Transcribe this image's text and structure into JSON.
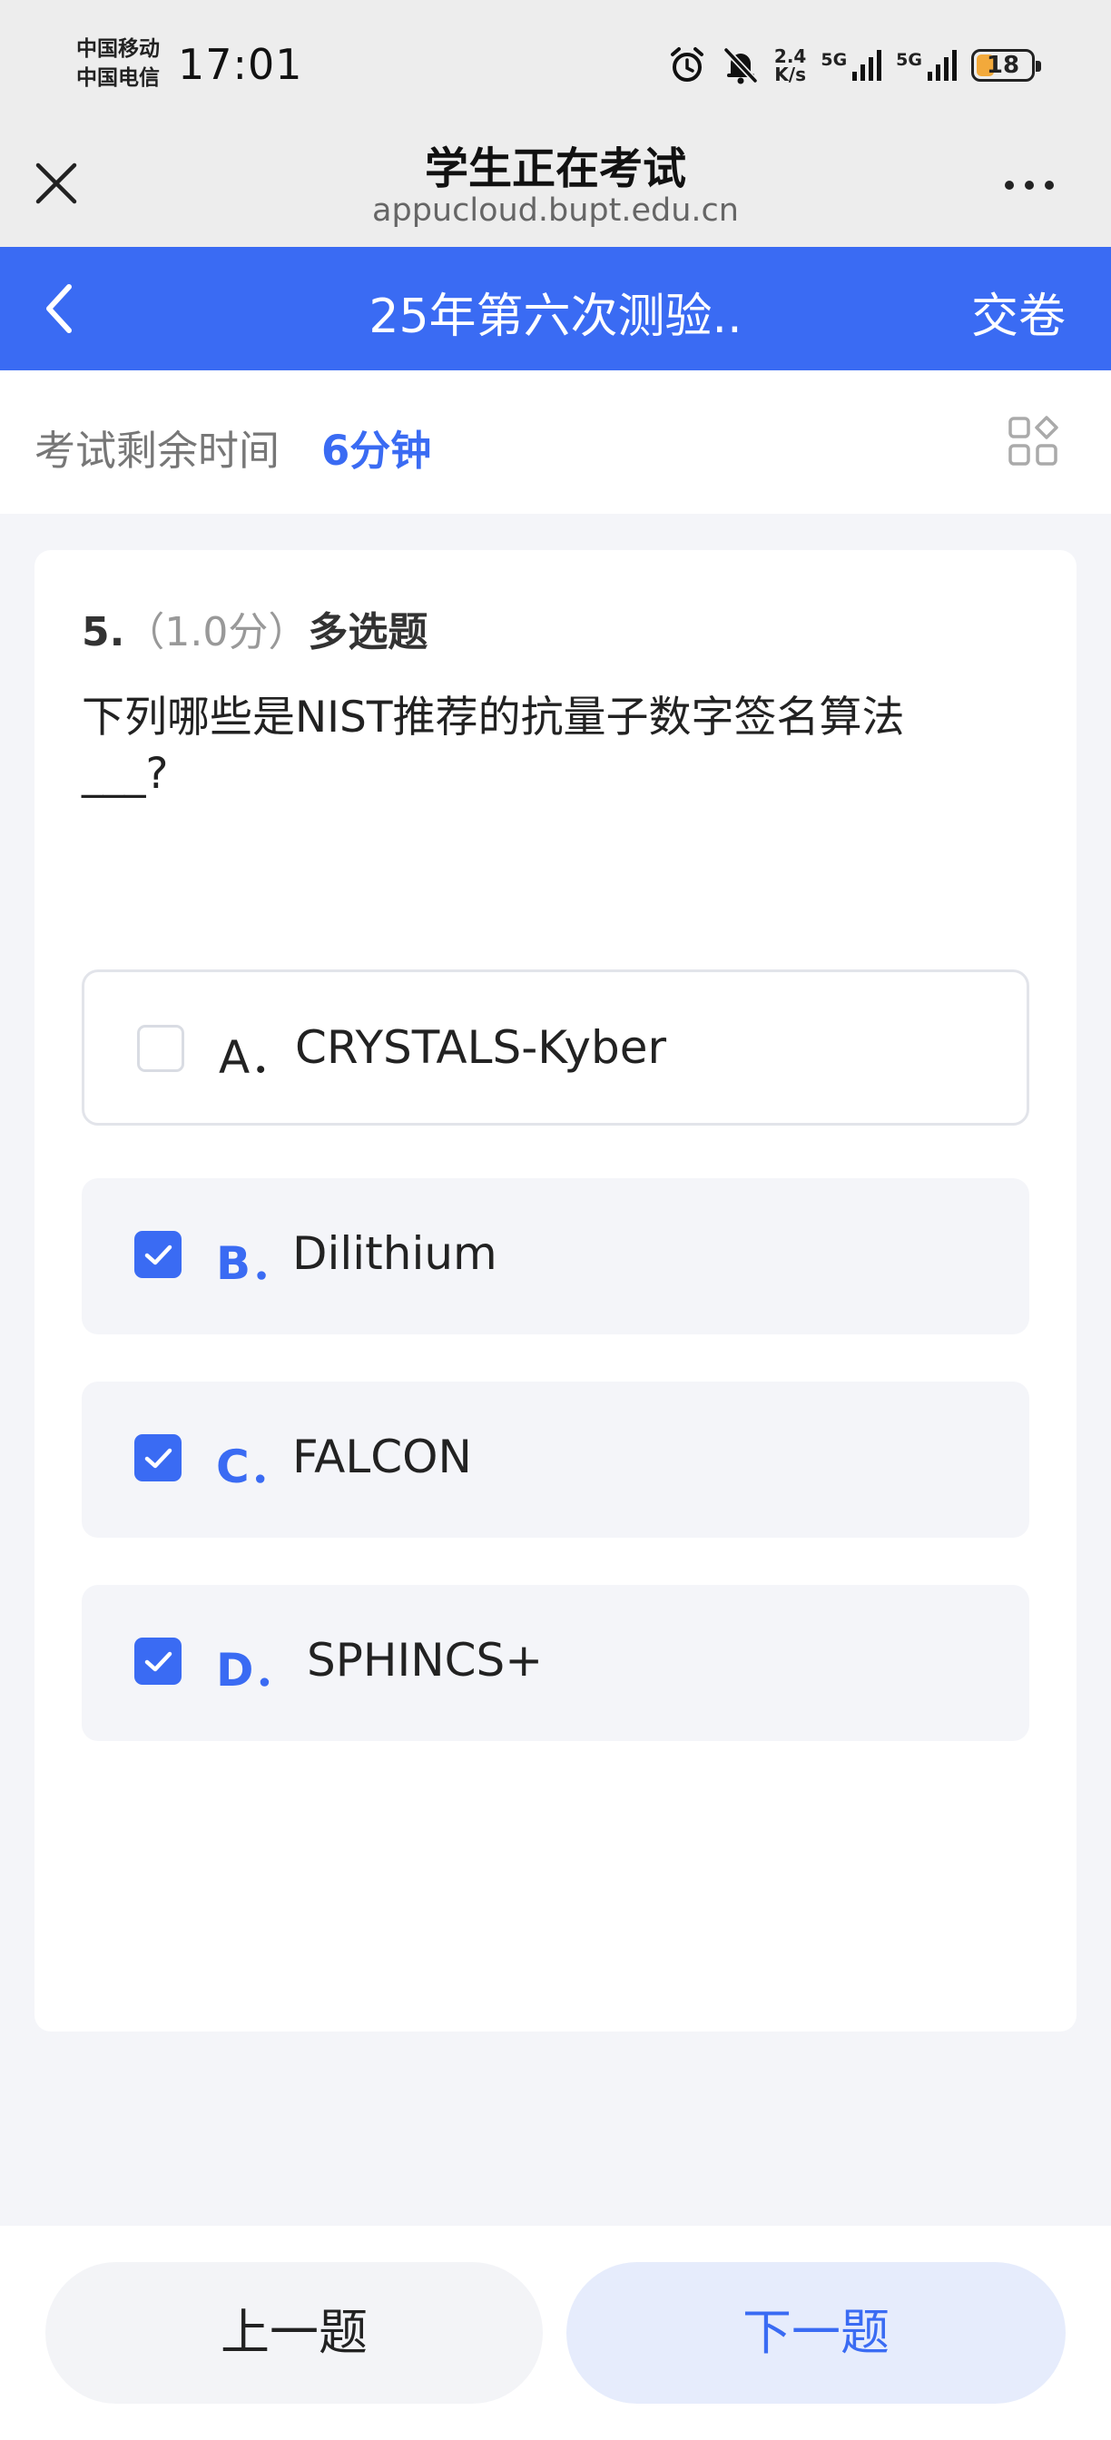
{
  "status_bar": {
    "carrier_1": "中国移动",
    "carrier_2": "中国电信",
    "time": "17:01",
    "net_speed_value": "2.4",
    "net_speed_unit": "K/s",
    "signal_1_label": "5G",
    "signal_2_label": "5G",
    "battery_level": "18",
    "icons": [
      "alarm-icon",
      "mute-bell-icon",
      "signal-icon",
      "battery-icon"
    ]
  },
  "browser": {
    "title": "学生正在考试",
    "url": "appucloud.bupt.edu.cn",
    "icons": [
      "close-icon",
      "more-dots-icon"
    ]
  },
  "header": {
    "exam_title": "25年第六次测验..",
    "submit_label": "交卷",
    "accent_color": "#3a6bf3"
  },
  "timer": {
    "label": "考试剩余时间",
    "value": "6分钟"
  },
  "question": {
    "number": "5.",
    "score": "（1.0分）",
    "type": "多选题",
    "text_line1": "下列哪些是NIST推荐的抗量子数字签名算法",
    "text_line2": "___?",
    "options": [
      {
        "letter": "A．",
        "text": "CRYSTALS-Kyber",
        "checked": false
      },
      {
        "letter": "B．",
        "text": "Dilithium",
        "checked": true
      },
      {
        "letter": "C．",
        "text": "FALCON",
        "checked": true
      },
      {
        "letter": "D．",
        "text": "SPHINCS+",
        "checked": true
      }
    ]
  },
  "footer": {
    "prev_label": "上一题",
    "next_label": "下一题"
  }
}
